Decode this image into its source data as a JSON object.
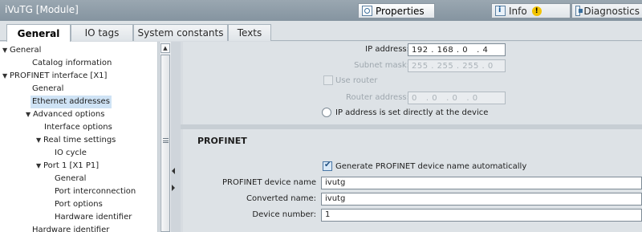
{
  "window": {
    "title": "iVuTG [Module]",
    "buttons": {
      "properties": "Properties",
      "info": "Info",
      "diagnostics": "Diagnostics"
    }
  },
  "tabs": [
    {
      "label": "General",
      "active": true
    },
    {
      "label": "IO tags",
      "active": false
    },
    {
      "label": "System constants",
      "active": false
    },
    {
      "label": "Texts",
      "active": false
    }
  ],
  "tree": [
    {
      "label": "General",
      "expanded": true
    },
    {
      "label": "Catalog information"
    },
    {
      "label": "PROFINET interface [X1]",
      "expanded": true
    },
    {
      "label": "General"
    },
    {
      "label": "Ethernet addresses",
      "selected": true
    },
    {
      "label": "Advanced options",
      "expanded": true
    },
    {
      "label": "Interface options"
    },
    {
      "label": "Real time settings",
      "expanded": true
    },
    {
      "label": "IO cycle"
    },
    {
      "label": "Port 1 [X1 P1]",
      "expanded": true
    },
    {
      "label": "General"
    },
    {
      "label": "Port interconnection"
    },
    {
      "label": "Port options"
    },
    {
      "label": "Hardware identifier"
    },
    {
      "label": "Hardware identifier"
    }
  ],
  "ip": {
    "ip_label": "IP address:",
    "ip_value": "192 . 168 . 0   . 4",
    "subnet_label": "Subnet mask:",
    "subnet_value": "255 . 255 . 255 . 0",
    "use_router_label": "Use router",
    "router_label": "Router address:",
    "router_value": "0   . 0   . 0   . 0",
    "set_directly_label": "IP address is set directly at the device"
  },
  "profinet": {
    "section_title": "PROFINET",
    "generate_label": "Generate PROFINET device name automatically",
    "device_name_label": "PROFINET device name",
    "device_name_value": "ivutg",
    "converted_label": "Converted name:",
    "converted_value": "ivutg",
    "device_number_label": "Device number:",
    "device_number_value": "1"
  },
  "icons": [
    "properties-icon",
    "info-icon",
    "warning-icon",
    "diagnostics-icon",
    "scroll-up-icon",
    "chevron-right-icon",
    "checkbox-icon",
    "radio-icon"
  ]
}
